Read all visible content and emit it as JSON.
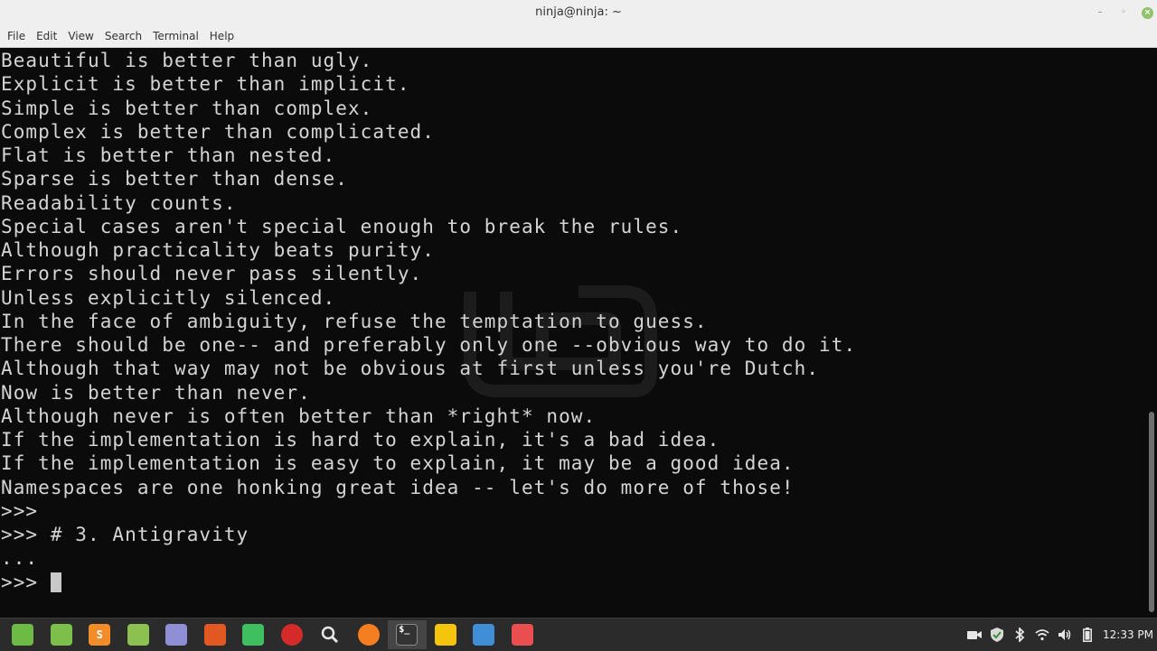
{
  "window": {
    "title": "ninja@ninja: ~",
    "controls": {
      "minimize": "–",
      "maximize": "◦",
      "close": "×"
    }
  },
  "menubar": {
    "items": [
      "File",
      "Edit",
      "View",
      "Search",
      "Terminal",
      "Help"
    ]
  },
  "terminal": {
    "lines": [
      "Beautiful is better than ugly.",
      "Explicit is better than implicit.",
      "Simple is better than complex.",
      "Complex is better than complicated.",
      "Flat is better than nested.",
      "Sparse is better than dense.",
      "Readability counts.",
      "Special cases aren't special enough to break the rules.",
      "Although practicality beats purity.",
      "Errors should never pass silently.",
      "Unless explicitly silenced.",
      "In the face of ambiguity, refuse the temptation to guess.",
      "There should be one-- and preferably only one --obvious way to do it.",
      "Although that way may not be obvious at first unless you're Dutch.",
      "Now is better than never.",
      "Although never is often better than *right* now.",
      "If the implementation is hard to explain, it's a bad idea.",
      "If the implementation is easy to explain, it may be a good idea.",
      "Namespaces are one honking great idea -- let's do more of those!",
      ">>>",
      ">>> # 3. Antigravity",
      "..."
    ],
    "prompt": ">>> "
  },
  "taskbar": {
    "apps": [
      {
        "name": "mint-menu-icon",
        "color": "#6dbb45"
      },
      {
        "name": "file-manager-icon",
        "color": "#7cbf4a"
      },
      {
        "name": "sublime-text-icon",
        "color": "#f28c28",
        "glyph": "S"
      },
      {
        "name": "folder-icon",
        "color": "#8cc152"
      },
      {
        "name": "text-editor-icon",
        "color": "#8f8fd6"
      },
      {
        "name": "system-tool-icon",
        "color": "#e25822"
      },
      {
        "name": "system-monitor-icon",
        "color": "#3fbf5f"
      },
      {
        "name": "map-pin-icon",
        "color": "#d42a2a"
      },
      {
        "name": "search-icon",
        "color": "#e6e6e6"
      },
      {
        "name": "firefox-icon",
        "color": "#f47e20"
      },
      {
        "name": "terminal-icon",
        "color": "#333333",
        "glyph": "$_",
        "active": true
      },
      {
        "name": "ubuntu-mail-icon",
        "color": "#f5c40d"
      },
      {
        "name": "screenshot-icon",
        "color": "#3f8ed6"
      },
      {
        "name": "pinwheel-icon",
        "color": "#e94f4f"
      }
    ],
    "clock": "12:33 PM"
  }
}
